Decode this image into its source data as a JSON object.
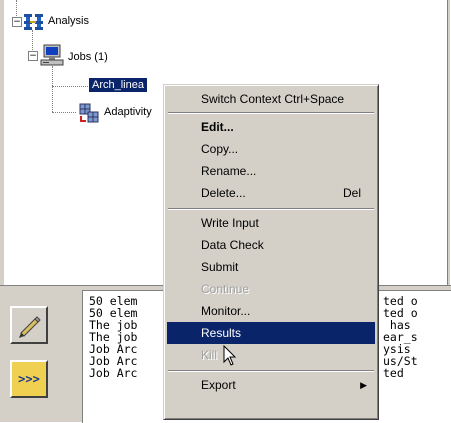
{
  "tree": {
    "root": {
      "label": "Analysis",
      "expander": "−",
      "icon": "analysis-icon"
    },
    "jobs": {
      "label": "Jobs (1)",
      "expander": "−",
      "icon": "computer-icon"
    },
    "job_item": {
      "label": "Arch_linea"
    },
    "adaptivity": {
      "label": "Adaptivity",
      "icon": "adaptivity-icon"
    }
  },
  "context_menu": {
    "switch_context": {
      "label": "Switch Context",
      "shortcut": "Ctrl+Space"
    },
    "edit": {
      "label": "Edit..."
    },
    "copy": {
      "label": "Copy..."
    },
    "rename": {
      "label": "Rename..."
    },
    "delete": {
      "label": "Delete...",
      "shortcut": "Del"
    },
    "write_input": {
      "label": "Write Input"
    },
    "data_check": {
      "label": "Data Check"
    },
    "submit": {
      "label": "Submit"
    },
    "continue": {
      "label": "Continue"
    },
    "monitor": {
      "label": "Monitor..."
    },
    "results": {
      "label": "Results"
    },
    "kill": {
      "label": "Kill"
    },
    "export": {
      "label": "Export",
      "arrow": "▶"
    }
  },
  "log": {
    "lines": [
      {
        "left": "50 elem",
        "right": "ted o"
      },
      {
        "left": "50 elem",
        "right": "ted o"
      },
      {
        "left": "The job",
        "right": " has "
      },
      {
        "left": "The job",
        "right": "ear_s"
      },
      {
        "left": "Job Arc",
        "right": "ysis "
      },
      {
        "left": "Job Arc",
        "right": "us/St"
      },
      {
        "left": "Job Arc",
        "right": "ted"
      }
    ]
  },
  "tools": {
    "pen_button": {
      "icon": "pencil-icon"
    },
    "run_button": {
      "label": ">>>"
    }
  },
  "colors": {
    "selection": "#0a246a",
    "panel": "#d4d0c8",
    "disabled_text": "#a0a0a0"
  }
}
